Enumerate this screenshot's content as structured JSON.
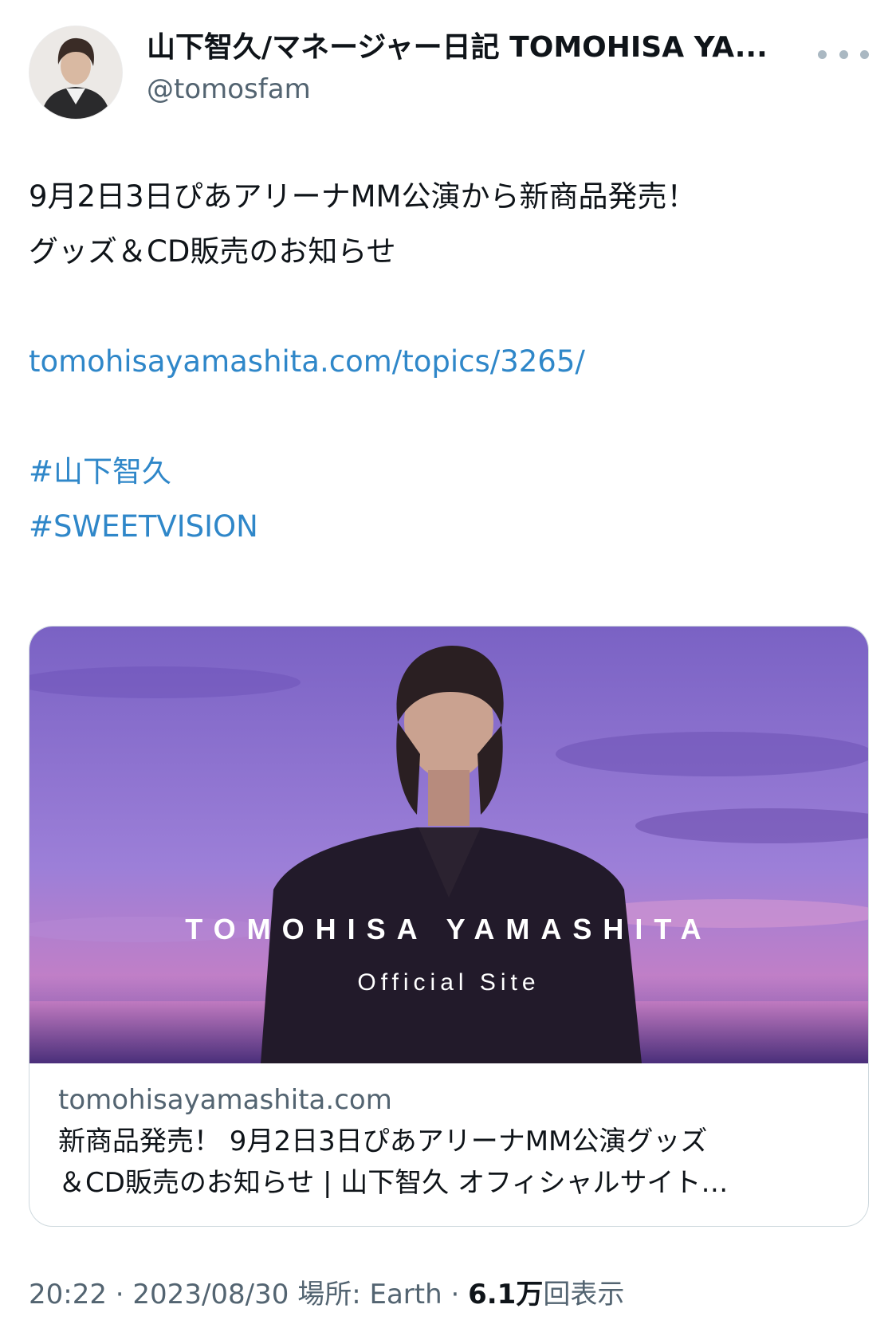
{
  "author": {
    "display_name": "山下智久/マネージャー日記 TOMOHISA YA...",
    "handle": "@tomosfam"
  },
  "tweet": {
    "lines": [
      "9月2日3日ぴあアリーナMM公演から新商品発売！",
      "グッズ＆CD販売のお知らせ"
    ],
    "url": "tomohisayamashita.com/topics/3265/",
    "hashtags": [
      "#山下智久",
      "#SWEETVISION"
    ]
  },
  "card": {
    "image_title": "TOMOHISA YAMASHITA",
    "image_subtitle": "Official Site",
    "domain": "tomohisayamashita.com",
    "title_line1": "新商品発売！ 9月2日3日ぴあアリーナMM公演グッズ",
    "title_line2": "＆CD販売のお知らせ | 山下智久 オフィシャルサイト…"
  },
  "meta": {
    "time": "20:22",
    "date": "2023/08/30",
    "location_label": "場所: Earth",
    "views_count": "6.1万",
    "views_label": "回表示"
  },
  "icons": {
    "more": "more-dots-icon"
  }
}
